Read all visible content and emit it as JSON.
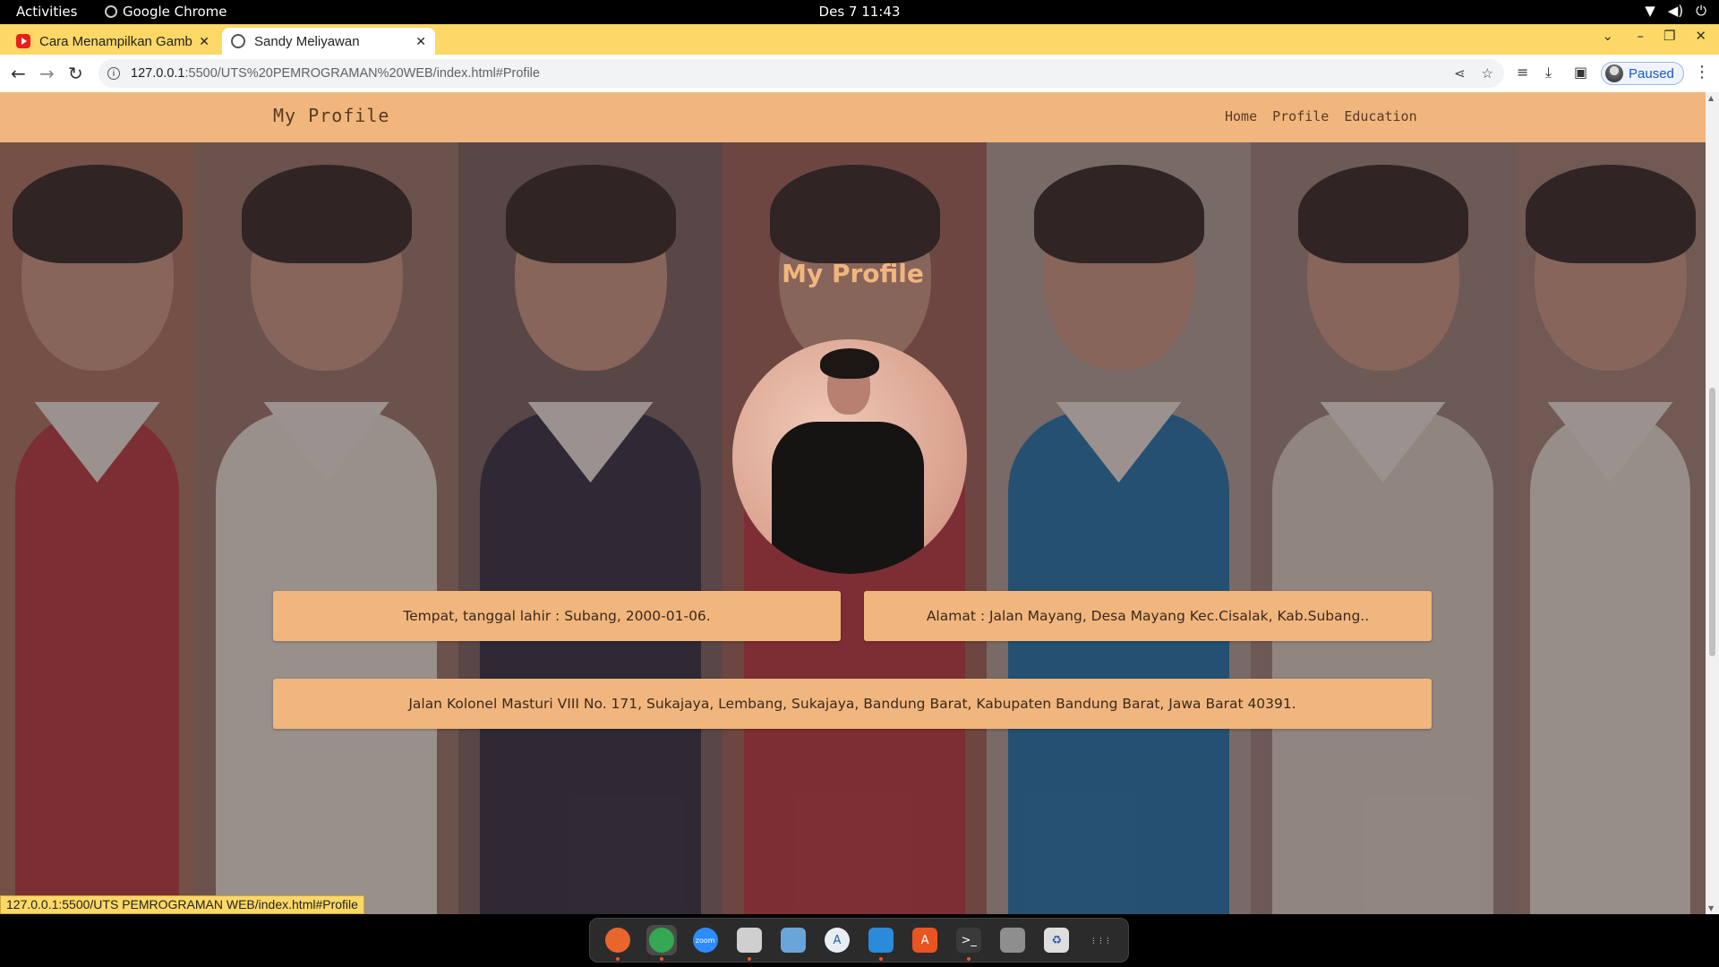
{
  "system_bar": {
    "activities": "Activities",
    "app_name": "Google Chrome",
    "clock": "Des 7  11:43"
  },
  "browser": {
    "tabs": [
      {
        "title": "Cara Menampilkan Gamb",
        "favicon": "youtube-icon",
        "active": false
      },
      {
        "title": "Sandy Meliyawan",
        "favicon": "globe-icon",
        "active": true
      }
    ],
    "url_host": "127.0.0.1",
    "url_rest": ":5500/UTS%20PEMROGRAMAN%20WEB/index.html#Profile",
    "profile_label": "Paused",
    "status_url": "127.0.0.1:5500/UTS PEMROGRAMAN WEB/index.html#Profile"
  },
  "site": {
    "brand": "My Profile",
    "nav": [
      "Home",
      "Profile",
      "Education"
    ],
    "section_title": "My Profile",
    "birth": "Tempat, tanggal lahir : Subang, 2000-01-06.",
    "address": "Alamat : Jalan Mayang, Desa Mayang Kec.Cisalak, Kab.Subang..",
    "full_address": "Jalan Kolonel Masturi VIII No. 171, Sukajaya, Lembang, Sukajaya, Bandung Barat, Kabupaten Bandung Barat, Jawa Barat 40391."
  },
  "colors": {
    "accent": "#f1b67d",
    "tabstrip": "#fdd866"
  },
  "background_photos": [
    {
      "name": "photo-glasses-red-shirt",
      "bg": "#9a6a58",
      "shirt": "#a8333a"
    },
    {
      "name": "photo-white-plaid-shirt",
      "bg": "#8d6d60",
      "shirt": "#d6d0c6"
    },
    {
      "name": "photo-dark-shirt",
      "bg": "#6e5a56",
      "shirt": "#2a2b3a"
    },
    {
      "name": "photo-glasses-red-shirt-2",
      "bg": "#8e5a50",
      "shirt": "#a8333a"
    },
    {
      "name": "photo-blue-jacket",
      "bg": "#a0948c",
      "shirt": "#1b6a9c"
    },
    {
      "name": "photo-hand-on-cheek",
      "bg": "#8f7a72",
      "shirt": "#c8bfb4"
    },
    {
      "name": "photo-white-plaid-shirt-2",
      "bg": "#95786c",
      "shirt": "#d2ccc2"
    }
  ],
  "dock": [
    {
      "name": "firefox-icon",
      "label": "",
      "color": "#e8662c",
      "running": true
    },
    {
      "name": "chrome-icon",
      "label": "",
      "color": "#34a853",
      "running": true,
      "active": true
    },
    {
      "name": "zoom-icon",
      "label": "zoom",
      "color": "#2d8cff",
      "running": false
    },
    {
      "name": "files-icon",
      "label": "",
      "color": "#cfcfcf",
      "running": true
    },
    {
      "name": "cube-app-icon",
      "label": "",
      "color": "#6aa5d9",
      "running": false
    },
    {
      "name": "app-store-icon",
      "label": "A",
      "color": "#e9eef5",
      "running": false
    },
    {
      "name": "vscode-icon",
      "label": "",
      "color": "#2b8ad9",
      "running": true
    },
    {
      "name": "software-center-icon",
      "label": "A",
      "color": "#e95420",
      "running": false
    },
    {
      "name": "terminal-icon",
      "label": ">_",
      "color": "#3a3a3a",
      "running": true
    },
    {
      "name": "disk-icon",
      "label": "",
      "color": "#8e8e8e",
      "running": false
    },
    {
      "name": "trash-icon",
      "label": "♻",
      "color": "#dedede",
      "running": false
    },
    {
      "name": "app-grid-icon",
      "label": "⋮⋮⋮",
      "color": "#2b2b2b",
      "running": false
    }
  ]
}
